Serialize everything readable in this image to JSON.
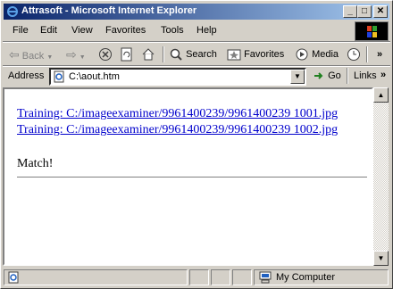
{
  "window": {
    "title": "Attrasoft - Microsoft Internet Explorer"
  },
  "title_buttons": {
    "minimize": "_",
    "maximize": "□",
    "close": "✕"
  },
  "menu": {
    "items": [
      "File",
      "Edit",
      "View",
      "Favorites",
      "Tools",
      "Help"
    ]
  },
  "toolbar": {
    "back": "Back",
    "search": "Search",
    "favorites": "Favorites",
    "media": "Media",
    "more": "»"
  },
  "address": {
    "label": "Address",
    "url": "C:\\aout.htm",
    "go": "Go",
    "links": "Links",
    "more": "»"
  },
  "content": {
    "links": [
      "Training: C:/imageexaminer/9961400239/9961400239 1001.jpg",
      "Training: C:/imageexaminer/9961400239/9961400239 1002.jpg"
    ],
    "result": "Match!"
  },
  "status": {
    "zone": "My Computer"
  },
  "colors": {
    "title_start": "#0a246a",
    "title_end": "#a6caf0",
    "link": "#0000cc"
  }
}
